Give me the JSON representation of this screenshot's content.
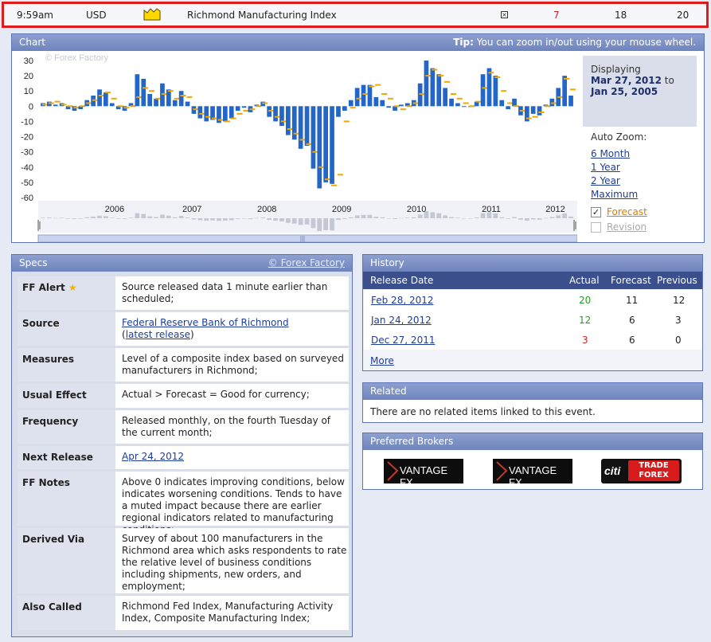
{
  "event": {
    "time": "9:59am",
    "currency": "USD",
    "impact_icon": "folder-impact-icon",
    "title": "Richmond Manufacturing Index",
    "actual": "7",
    "forecast": "18",
    "previous": "20"
  },
  "chart": {
    "header": "Chart",
    "tip_bold": "Tip:",
    "tip_text": "You can zoom in/out using your mouse wheel.",
    "watermark": "© Forex Factory",
    "displaying_label": "Displaying",
    "date_from": "Mar 27, 2012",
    "date_to_word": "to",
    "date_to": "Jan 25, 2005",
    "auto_zoom_label": "Auto Zoom:",
    "zoom_options": [
      "6 Month",
      "1 Year",
      "2 Year",
      "Maximum"
    ],
    "forecast_checkbox": "Forecast",
    "revision_checkbox": "Revision",
    "colors": {
      "bar": "#2466c8",
      "forecast": "#f0a800"
    }
  },
  "chart_data": {
    "type": "bar",
    "ylim": [
      -60,
      30
    ],
    "yticks": [
      30,
      20,
      10,
      0,
      -10,
      -20,
      -30,
      -40,
      -50,
      -60
    ],
    "xtick_labels": [
      "2006",
      "2007",
      "2008",
      "2009",
      "2010",
      "2011",
      "2012"
    ],
    "series": [
      {
        "name": "Actual",
        "values": [
          2,
          3,
          1,
          2,
          -2,
          -3,
          -2,
          4,
          7,
          11,
          9,
          2,
          -2,
          -3,
          2,
          21,
          18,
          8,
          5,
          15,
          11,
          4,
          10,
          3,
          -5,
          -8,
          -10,
          -9,
          -11,
          -10,
          -8,
          -3,
          -1,
          -4,
          1,
          3,
          -7,
          -10,
          -13,
          -19,
          -22,
          -28,
          -26,
          -41,
          -54,
          -50,
          -51,
          -7,
          -3,
          4,
          12,
          14,
          14,
          6,
          4,
          -1,
          -3,
          1,
          2,
          4,
          15,
          30,
          25,
          21,
          12,
          5,
          2,
          0,
          0,
          3,
          21,
          25,
          20,
          4,
          -2,
          5,
          -6,
          -10,
          -5,
          -6,
          1,
          5,
          12,
          20,
          7
        ]
      },
      {
        "name": "Forecast",
        "values": [
          1,
          2,
          3,
          1,
          0,
          -1,
          0,
          2,
          4,
          7,
          9,
          5,
          0,
          -1,
          0,
          6,
          12,
          10,
          5,
          8,
          10,
          5,
          7,
          6,
          -2,
          -5,
          -7,
          -8,
          -9,
          -10,
          -8,
          -5,
          -3,
          -2,
          0,
          2,
          -3,
          -7,
          -10,
          -15,
          -18,
          -22,
          -25,
          -30,
          -40,
          -48,
          -52,
          -45,
          -10,
          -1,
          5,
          8,
          13,
          14,
          8,
          5,
          0,
          -2,
          0,
          2,
          8,
          20,
          24,
          20,
          16,
          8,
          5,
          2,
          0,
          3,
          12,
          22,
          19,
          10,
          2,
          0,
          -3,
          -8,
          -7,
          -4,
          0,
          2,
          6,
          18,
          11
        ]
      }
    ]
  },
  "specs": {
    "header": "Specs",
    "credit": "© Forex Factory",
    "rows": {
      "ff_alert": {
        "label": "FF Alert",
        "value": "Source released data 1 minute earlier than scheduled;"
      },
      "source": {
        "label": "Source",
        "link": "Federal Reserve Bank of Richmond",
        "paren_open": "(",
        "link2": "latest release",
        "paren_close": ")"
      },
      "measures": {
        "label": "Measures",
        "value": "Level of a composite index based on surveyed manufacturers in Richmond;"
      },
      "usual_effect": {
        "label": "Usual Effect",
        "value": "Actual > Forecast = Good for currency;"
      },
      "frequency": {
        "label": "Frequency",
        "value": "Released monthly, on the fourth Tuesday of the current month;"
      },
      "next_release": {
        "label": "Next Release",
        "link": "Apr 24, 2012"
      },
      "ff_notes": {
        "label": "FF Notes",
        "value": "Above 0 indicates improving conditions, below indicates worsening conditions. Tends to have a muted impact because there are earlier regional indicators related to manufacturing conditions;"
      },
      "derived_via": {
        "label": "Derived Via",
        "value": "Survey of about 100 manufacturers in the Richmond area which asks respondents to rate the relative level of business conditions including shipments, new orders, and employment;"
      },
      "also_called": {
        "label": "Also Called",
        "value": "Richmond Fed Index, Manufacturing Activity Index, Composite Manufacturing Index;"
      }
    }
  },
  "history": {
    "header": "History",
    "columns": [
      "Release Date",
      "Actual",
      "Forecast",
      "Previous"
    ],
    "rows": [
      {
        "date": "Feb 28, 2012",
        "actual": "20",
        "forecast": "11",
        "previous": "12",
        "actual_color": "#2a9a2a"
      },
      {
        "date": "Jan 24, 2012",
        "actual": "12",
        "forecast": "6",
        "previous": "3",
        "actual_color": "#2a9a2a"
      },
      {
        "date": "Dec 27, 2011",
        "actual": "3",
        "forecast": "6",
        "previous": "0",
        "actual_color": "#cc2222"
      }
    ],
    "more": "More"
  },
  "related": {
    "header": "Related",
    "text": "There are no related items linked to this event."
  },
  "brokers": {
    "header": "Preferred Brokers",
    "items": [
      {
        "name": "VANTAGE FX"
      },
      {
        "name": "VANTAGE FX"
      },
      {
        "logo": "citi",
        "line1": "TRADE",
        "line2": "FOREX"
      }
    ]
  }
}
